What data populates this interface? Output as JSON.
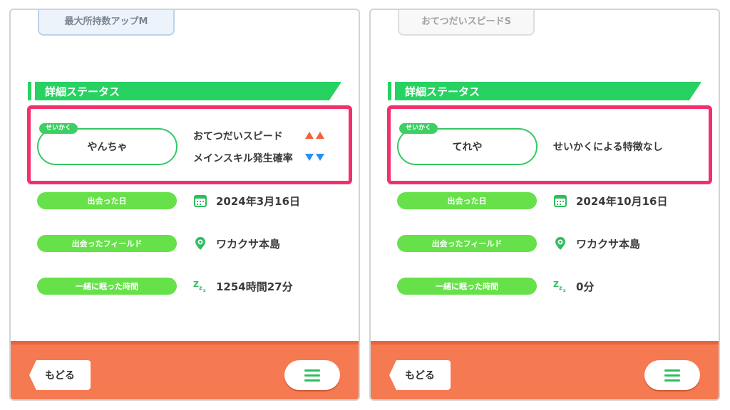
{
  "panels": [
    {
      "skill_label": "最大所持数アップM",
      "section_title": "詳細ステータス",
      "nature_tag": "せいかく",
      "nature_name": "やんちゃ",
      "nature_effects": [
        {
          "label": "おてつだいスピード",
          "direction": "up"
        },
        {
          "label": "メインスキル発生確率",
          "direction": "down"
        }
      ],
      "details": [
        {
          "label": "出会った日",
          "value": "2024年3月16日",
          "icon": "calendar-icon"
        },
        {
          "label": "出会ったフィールド",
          "value": "ワカクサ本島",
          "icon": "location-pin-icon"
        },
        {
          "label": "一緒に眠った時間",
          "value": "1254時間27分",
          "icon": "zzz-sleep-icon"
        }
      ],
      "footer": {
        "back_label": "もどる",
        "menu_icon": "hamburger-menu-icon"
      }
    },
    {
      "skill_label": "おてつだいスピードS",
      "section_title": "詳細ステータス",
      "nature_tag": "せいかく",
      "nature_name": "てれや",
      "nature_effect_text": "せいかくによる特徴なし",
      "details": [
        {
          "label": "出会った日",
          "value": "2024年10月16日",
          "icon": "calendar-icon"
        },
        {
          "label": "出会ったフィールド",
          "value": "ワカクサ本島",
          "icon": "location-pin-icon"
        },
        {
          "label": "一緒に眠った時間",
          "value": "0分",
          "icon": "zzz-sleep-icon"
        }
      ],
      "footer": {
        "back_label": "もどる",
        "menu_icon": "hamburger-menu-icon"
      }
    }
  ],
  "colors": {
    "accent_green": "#27d262",
    "label_green": "#67e14a",
    "highlight_pink": "#f2306b",
    "footer_orange": "#f57a51",
    "up_arrow": "#f2623a",
    "down_arrow": "#2a8ff0"
  }
}
